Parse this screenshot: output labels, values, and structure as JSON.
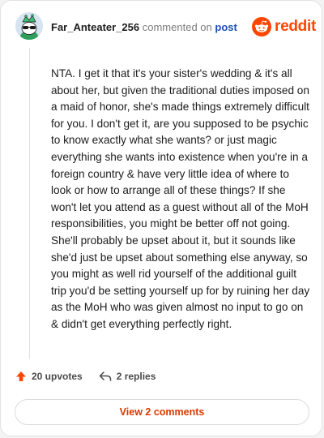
{
  "comment": {
    "username": "Far_Anteater_256",
    "meta_text": "commented on",
    "post_link": "post",
    "body": "NTA. I get it that it's your sister's wedding & it's all about her, but given the traditional duties imposed on a maid of honor, she's made things extremely difficult for you. I don't get it, are you supposed to be psychic to know exactly what she wants? or just magic everything she wants into existence when you're in a foreign country & have very little idea of where to look or how to arrange all of these things? If she won't let you attend as a guest without all of the MoH responsibilities, you might be better off not going. She'll probably be upset about it, but it sounds like she'd just be upset about something else anyway, so you might as well rid yourself of the additional guilt trip you'd be setting yourself up for by ruining her day as the MoH who was given almost no input to go on & didn't get everything perfectly right."
  },
  "brand": {
    "name": "reddit",
    "icon": "reddit-logo-icon",
    "color": "#ff4500"
  },
  "actions": {
    "upvotes": "20 upvotes",
    "upvote_icon": "upvote-arrow-icon",
    "replies": "2 replies",
    "reply_icon": "reply-arrow-icon"
  },
  "footer": {
    "view_comments": "View 2 comments"
  },
  "colors": {
    "accent": "#ff4500",
    "link": "#1c4fb5",
    "button_text": "#d93900"
  }
}
